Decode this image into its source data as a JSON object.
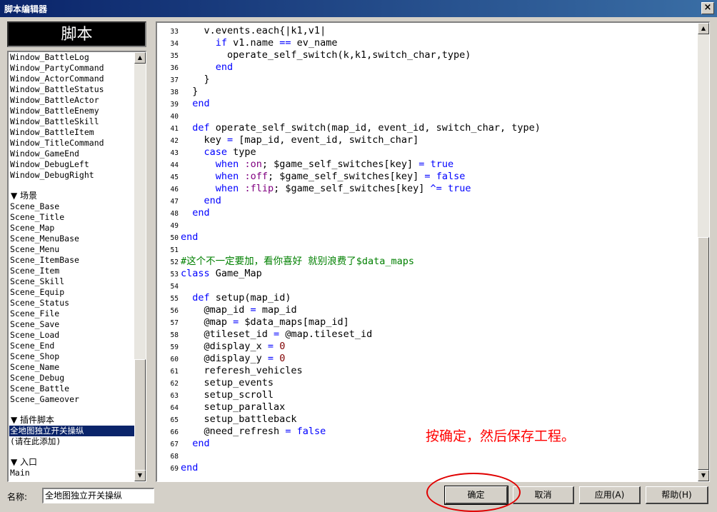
{
  "window": {
    "title": "脚本编辑器",
    "close_label": "×"
  },
  "script_list": {
    "header": "脚本",
    "items": [
      {
        "label": "Window_BattleLog",
        "type": "item"
      },
      {
        "label": "Window_PartyCommand",
        "type": "item"
      },
      {
        "label": "Window_ActorCommand",
        "type": "item"
      },
      {
        "label": "Window_BattleStatus",
        "type": "item"
      },
      {
        "label": "Window_BattleActor",
        "type": "item"
      },
      {
        "label": "Window_BattleEnemy",
        "type": "item"
      },
      {
        "label": "Window_BattleSkill",
        "type": "item"
      },
      {
        "label": "Window_BattleItem",
        "type": "item"
      },
      {
        "label": "Window_TitleCommand",
        "type": "item"
      },
      {
        "label": "Window_GameEnd",
        "type": "item"
      },
      {
        "label": "Window_DebugLeft",
        "type": "item"
      },
      {
        "label": "Window_DebugRight",
        "type": "item"
      },
      {
        "label": "",
        "type": "spacer"
      },
      {
        "label": "▼ 场景",
        "type": "group"
      },
      {
        "label": "Scene_Base",
        "type": "item"
      },
      {
        "label": "Scene_Title",
        "type": "item"
      },
      {
        "label": "Scene_Map",
        "type": "item"
      },
      {
        "label": "Scene_MenuBase",
        "type": "item"
      },
      {
        "label": "Scene_Menu",
        "type": "item"
      },
      {
        "label": "Scene_ItemBase",
        "type": "item"
      },
      {
        "label": "Scene_Item",
        "type": "item"
      },
      {
        "label": "Scene_Skill",
        "type": "item"
      },
      {
        "label": "Scene_Equip",
        "type": "item"
      },
      {
        "label": "Scene_Status",
        "type": "item"
      },
      {
        "label": "Scene_File",
        "type": "item"
      },
      {
        "label": "Scene_Save",
        "type": "item"
      },
      {
        "label": "Scene_Load",
        "type": "item"
      },
      {
        "label": "Scene_End",
        "type": "item"
      },
      {
        "label": "Scene_Shop",
        "type": "item"
      },
      {
        "label": "Scene_Name",
        "type": "item"
      },
      {
        "label": "Scene_Debug",
        "type": "item"
      },
      {
        "label": "Scene_Battle",
        "type": "item"
      },
      {
        "label": "Scene_Gameover",
        "type": "item"
      },
      {
        "label": "",
        "type": "spacer"
      },
      {
        "label": "▼ 插件脚本",
        "type": "group"
      },
      {
        "label": "全地图独立开关操纵",
        "type": "item",
        "selected": true
      },
      {
        "label": "(请在此添加)",
        "type": "item"
      },
      {
        "label": "",
        "type": "spacer"
      },
      {
        "label": "▼ 入口",
        "type": "group"
      },
      {
        "label": "Main",
        "type": "item"
      }
    ]
  },
  "editor": {
    "lines": [
      {
        "n": "33",
        "parts": [
          [
            "plain",
            "    v.events.each{|k1,v1|"
          ]
        ]
      },
      {
        "n": "34",
        "parts": [
          [
            "plain",
            "      "
          ],
          [
            "kw",
            "if"
          ],
          [
            "plain",
            " v1.name "
          ],
          [
            "op",
            "=="
          ],
          [
            "plain",
            " ev_name"
          ]
        ]
      },
      {
        "n": "35",
        "parts": [
          [
            "plain",
            "        operate_self_switch(k,k1,switch_char,type)"
          ]
        ]
      },
      {
        "n": "36",
        "parts": [
          [
            "plain",
            "      "
          ],
          [
            "kw",
            "end"
          ]
        ]
      },
      {
        "n": "37",
        "parts": [
          [
            "plain",
            "    }"
          ]
        ]
      },
      {
        "n": "38",
        "parts": [
          [
            "plain",
            "  }"
          ]
        ]
      },
      {
        "n": "39",
        "parts": [
          [
            "plain",
            "  "
          ],
          [
            "kw",
            "end"
          ]
        ]
      },
      {
        "n": "40",
        "parts": [
          [
            "plain",
            ""
          ]
        ]
      },
      {
        "n": "41",
        "parts": [
          [
            "plain",
            "  "
          ],
          [
            "kw",
            "def"
          ],
          [
            "plain",
            " operate_self_switch(map_id, event_id, switch_char, type)"
          ]
        ]
      },
      {
        "n": "42",
        "parts": [
          [
            "plain",
            "    key "
          ],
          [
            "op",
            "="
          ],
          [
            "plain",
            " [map_id, event_id, switch_char]"
          ]
        ]
      },
      {
        "n": "43",
        "parts": [
          [
            "plain",
            "    "
          ],
          [
            "kw",
            "case"
          ],
          [
            "plain",
            " type"
          ]
        ]
      },
      {
        "n": "44",
        "parts": [
          [
            "plain",
            "      "
          ],
          [
            "kw",
            "when"
          ],
          [
            "plain",
            " "
          ],
          [
            "str",
            ":on"
          ],
          [
            "plain",
            "; $game_self_switches[key] "
          ],
          [
            "op",
            "="
          ],
          [
            "plain",
            " "
          ],
          [
            "kw",
            "true"
          ]
        ]
      },
      {
        "n": "45",
        "parts": [
          [
            "plain",
            "      "
          ],
          [
            "kw",
            "when"
          ],
          [
            "plain",
            " "
          ],
          [
            "str",
            ":off"
          ],
          [
            "plain",
            "; $game_self_switches[key] "
          ],
          [
            "op",
            "="
          ],
          [
            "plain",
            " "
          ],
          [
            "kw",
            "false"
          ]
        ]
      },
      {
        "n": "46",
        "parts": [
          [
            "plain",
            "      "
          ],
          [
            "kw",
            "when"
          ],
          [
            "plain",
            " "
          ],
          [
            "str",
            ":flip"
          ],
          [
            "plain",
            "; $game_self_switches[key] "
          ],
          [
            "op",
            "^="
          ],
          [
            "plain",
            " "
          ],
          [
            "kw",
            "true"
          ]
        ]
      },
      {
        "n": "47",
        "parts": [
          [
            "plain",
            "    "
          ],
          [
            "kw",
            "end"
          ]
        ]
      },
      {
        "n": "48",
        "parts": [
          [
            "plain",
            "  "
          ],
          [
            "kw",
            "end"
          ]
        ]
      },
      {
        "n": "49",
        "parts": [
          [
            "plain",
            ""
          ]
        ]
      },
      {
        "n": "50",
        "parts": [
          [
            "kw",
            "end"
          ]
        ]
      },
      {
        "n": "51",
        "parts": [
          [
            "plain",
            ""
          ]
        ]
      },
      {
        "n": "52",
        "parts": [
          [
            "cm",
            "#这个不一定要加，看你喜好 就别浪费了$data_maps"
          ]
        ]
      },
      {
        "n": "53",
        "parts": [
          [
            "kw",
            "class"
          ],
          [
            "plain",
            " Game_Map"
          ]
        ]
      },
      {
        "n": "54",
        "parts": [
          [
            "plain",
            ""
          ]
        ]
      },
      {
        "n": "55",
        "parts": [
          [
            "plain",
            "  "
          ],
          [
            "kw",
            "def"
          ],
          [
            "plain",
            " setup(map_id)"
          ]
        ]
      },
      {
        "n": "56",
        "parts": [
          [
            "plain",
            "    @map_id "
          ],
          [
            "op",
            "="
          ],
          [
            "plain",
            " map_id"
          ]
        ]
      },
      {
        "n": "57",
        "parts": [
          [
            "plain",
            "    @map "
          ],
          [
            "op",
            "="
          ],
          [
            "plain",
            " $data_maps[map_id]"
          ]
        ]
      },
      {
        "n": "58",
        "parts": [
          [
            "plain",
            "    @tileset_id "
          ],
          [
            "op",
            "="
          ],
          [
            "plain",
            " @map.tileset_id"
          ]
        ]
      },
      {
        "n": "59",
        "parts": [
          [
            "plain",
            "    @display_x "
          ],
          [
            "op",
            "="
          ],
          [
            "plain",
            " "
          ],
          [
            "num",
            "0"
          ]
        ]
      },
      {
        "n": "60",
        "parts": [
          [
            "plain",
            "    @display_y "
          ],
          [
            "op",
            "="
          ],
          [
            "plain",
            " "
          ],
          [
            "num",
            "0"
          ]
        ]
      },
      {
        "n": "61",
        "parts": [
          [
            "plain",
            "    referesh_vehicles"
          ]
        ]
      },
      {
        "n": "62",
        "parts": [
          [
            "plain",
            "    setup_events"
          ]
        ]
      },
      {
        "n": "63",
        "parts": [
          [
            "plain",
            "    setup_scroll"
          ]
        ]
      },
      {
        "n": "64",
        "parts": [
          [
            "plain",
            "    setup_parallax"
          ]
        ]
      },
      {
        "n": "65",
        "parts": [
          [
            "plain",
            "    setup_battleback"
          ]
        ]
      },
      {
        "n": "66",
        "parts": [
          [
            "plain",
            "    @need_refresh "
          ],
          [
            "op",
            "="
          ],
          [
            "plain",
            " "
          ],
          [
            "kw",
            "false"
          ]
        ]
      },
      {
        "n": "67",
        "parts": [
          [
            "plain",
            "  "
          ],
          [
            "kw",
            "end"
          ]
        ]
      },
      {
        "n": "68",
        "parts": [
          [
            "plain",
            ""
          ]
        ]
      },
      {
        "n": "69",
        "parts": [
          [
            "kw",
            "end"
          ]
        ]
      }
    ]
  },
  "annotation": "按确定，然后保存工程。",
  "footer": {
    "name_label": "名称:",
    "name_value": "全地图独立开关操纵",
    "ok": "确定",
    "cancel": "取消",
    "apply": "应用(A)",
    "help": "帮助(H)"
  }
}
